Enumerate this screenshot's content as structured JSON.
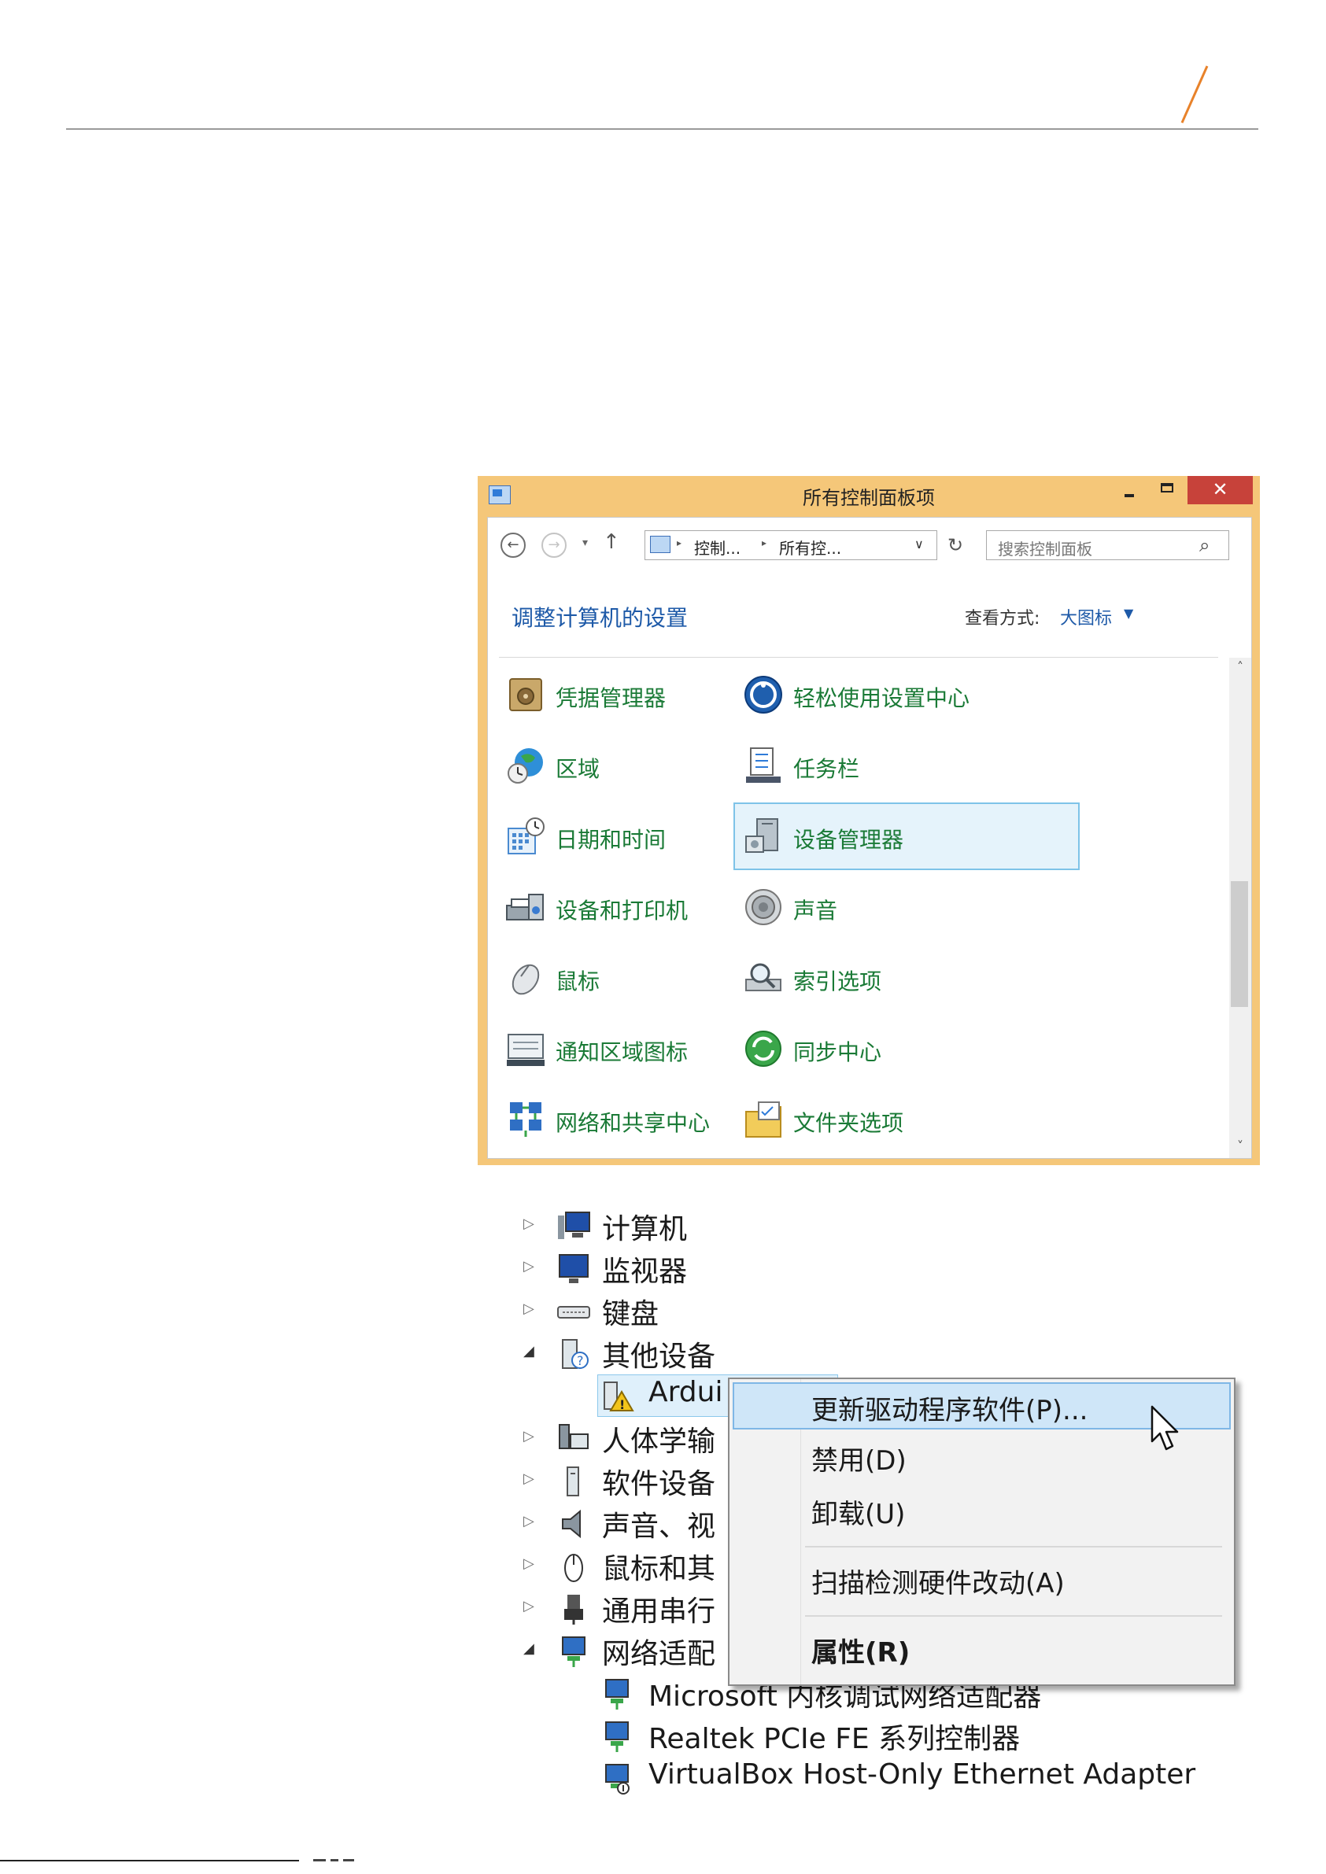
{
  "window": {
    "title": "所有控制面板项",
    "close_glyph": "✕",
    "nav": {
      "back": "←",
      "forward": "→",
      "recent": "▾",
      "up": "↑",
      "sep": "▸",
      "dropdown": "∨",
      "refresh": "↻"
    },
    "address": {
      "crumb1": "控制...",
      "crumb2": "所有控..."
    },
    "search": {
      "placeholder": "搜索控制面板",
      "icon": "⌕"
    },
    "heading": "调整计算机的设置",
    "view_by_label": "查看方式:",
    "view_by_value": "大图标",
    "view_dd": "▼",
    "scroll": {
      "up": "˄",
      "down": "˅"
    },
    "items": [
      {
        "label": "凭据管理器",
        "icon": "credential-manager-icon"
      },
      {
        "label": "轻松使用设置中心",
        "icon": "ease-of-access-icon"
      },
      {
        "label": "区域",
        "icon": "region-icon"
      },
      {
        "label": "任务栏",
        "icon": "taskbar-icon"
      },
      {
        "label": "日期和时间",
        "icon": "date-time-icon"
      },
      {
        "label": "设备管理器",
        "icon": "device-manager-icon",
        "selected": true
      },
      {
        "label": "设备和打印机",
        "icon": "devices-printers-icon"
      },
      {
        "label": "声音",
        "icon": "sound-icon"
      },
      {
        "label": "鼠标",
        "icon": "mouse-icon"
      },
      {
        "label": "索引选项",
        "icon": "indexing-icon"
      },
      {
        "label": "通知区域图标",
        "icon": "notification-icons-icon"
      },
      {
        "label": "同步中心",
        "icon": "sync-center-icon"
      },
      {
        "label": "网络和共享中心",
        "icon": "network-sharing-icon"
      },
      {
        "label": "文件夹选项",
        "icon": "folder-options-icon"
      }
    ]
  },
  "device_manager": {
    "collapsed_arrow": "▷",
    "expanded_arrow": "◢",
    "rows": [
      {
        "label": "计算机"
      },
      {
        "label": "监视器"
      },
      {
        "label": "键盘"
      },
      {
        "label": "其他设备"
      },
      {
        "label": "Ardui"
      },
      {
        "label": "人体学输"
      },
      {
        "label": "软件设备"
      },
      {
        "label": "声音、视"
      },
      {
        "label": "鼠标和其"
      },
      {
        "label": "通用串行"
      },
      {
        "label": "网络适配"
      },
      {
        "label": "Microsoft 内核调试网络适配器"
      },
      {
        "label": "Realtek PCIe FE 系列控制器"
      },
      {
        "label": "VirtualBox Host-Only Ethernet Adapter"
      }
    ]
  },
  "context_menu": {
    "items": [
      {
        "label": "更新驱动程序软件(P)..."
      },
      {
        "label": "禁用(D)"
      },
      {
        "label": "卸载(U)"
      },
      {
        "label": "扫描检测硬件改动(A)"
      },
      {
        "label": "属性(R)"
      }
    ]
  },
  "colors": {
    "accent_orange": "#e8822a",
    "window_frame": "#f5c779",
    "close_red": "#c7423a",
    "link_blue": "#1e5aa8",
    "item_green": "#1a7a36",
    "selection_bg": "#e5f3fb",
    "selection_border": "#7ec3e8"
  }
}
